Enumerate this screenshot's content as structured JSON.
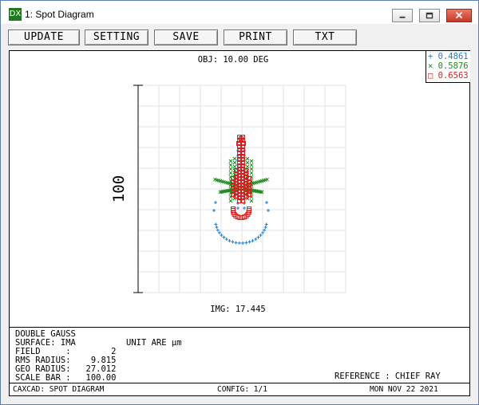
{
  "window": {
    "icon_text": "DX",
    "title": "1: Spot Diagram",
    "close_color": "#c83a24"
  },
  "toolbar": {
    "buttons": [
      "UPDATE",
      "SETTING",
      "SAVE",
      "PRINT",
      "TXT"
    ]
  },
  "plot": {
    "obj_label": "OBJ: 10.00 DEG",
    "img_label": "IMG: 17.445",
    "scale_label": "100"
  },
  "legend": {
    "items": [
      {
        "marker": "+",
        "wavelength": "0.4861",
        "color": "#1e7fd0"
      },
      {
        "marker": "×",
        "wavelength": "0.5876",
        "color": "#1e8a1e"
      },
      {
        "marker": "□",
        "wavelength": "0.6563",
        "color": "#e01b1b"
      }
    ]
  },
  "info": {
    "lens": "DOUBLE GAUSS",
    "surface": "SURFACE: IMA",
    "unit": "UNIT ARE µm",
    "field": "FIELD     :        2",
    "rms": "RMS RADIUS:    9.815",
    "geo": "GEO RADIUS:   27.012",
    "scale": "SCALE BAR :   100.00",
    "reference": "REFERENCE : CHIEF RAY"
  },
  "status": {
    "app": "CAXCAD: SPOT DIAGRAM",
    "config": "CONFIG: 1/1",
    "date": "MON NOV 22 2021"
  }
}
